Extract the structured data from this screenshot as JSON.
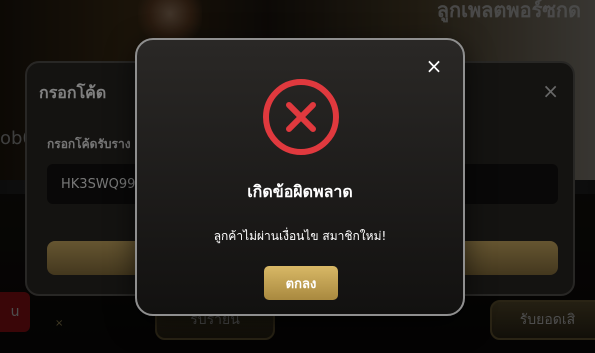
{
  "background": {
    "banner_text": "ลูกเพลตพอร์ซกด",
    "code_fragment": "ob0",
    "left_button_text": "u",
    "card_left_text": "รับรายนิ",
    "card_right_text": "รับยอดเสิ",
    "deco_x": "×"
  },
  "code_dialog": {
    "title": "กรอกโค้ด",
    "close_icon": "×",
    "label": "กรอกโค้ดรับราง",
    "input_value": "HK3SWQ99"
  },
  "error_modal": {
    "close_icon": "×",
    "title": "เกิดข้อผิดพลาด",
    "message": "ลูกค้าไม่ผ่านเงื่อนไข สมาชิกใหม่!",
    "ok_label": "ตกลง",
    "icon": "error-x-icon",
    "colors": {
      "icon_red": "#e0393e",
      "button_gold": "#c9a64f"
    }
  }
}
